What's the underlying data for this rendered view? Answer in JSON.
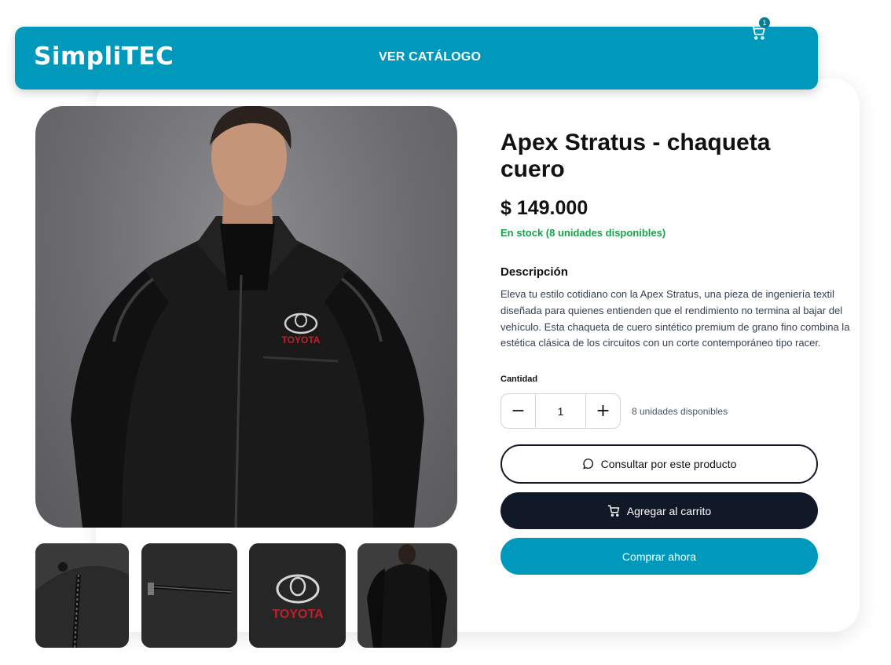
{
  "header": {
    "logo": "SimpliTEC",
    "nav_link": "VER CATÁLOGO",
    "cart_count": "1",
    "cart_icon": "cart-icon",
    "background": "#0099bb"
  },
  "gallery": {
    "main_image": "product-photo-man-in-leather-jacket",
    "main_logo_text": "TOYOTA",
    "thumbnails": [
      {
        "name": "thumb-zipper-collar"
      },
      {
        "name": "thumb-pocket-zipper"
      },
      {
        "name": "thumb-toyota-logo",
        "text": "TOYOTA"
      },
      {
        "name": "thumb-back-view"
      }
    ]
  },
  "product": {
    "title": "Apex Stratus - chaqueta cuero",
    "price": "$ 149.000",
    "stock": "En stock (8 unidades disponibles)",
    "stock_color": "#16a34a",
    "description_heading": "Descripción",
    "description": "Eleva tu estilo cotidiano con la Apex Stratus, una pieza de ingeniería textil diseñada para quienes entienden que el rendimiento no termina al bajar del vehículo. Esta chaqueta de cuero sintético premium de grano fino combina la estética clásica de los circuitos con un corte contemporáneo tipo racer.",
    "quantity_label": "Cantidad",
    "quantity_value": "1",
    "quantity_minus": "−",
    "quantity_plus": "+",
    "quantity_available": "8 unidades disponibles"
  },
  "actions": {
    "consult_label": "Consultar por este producto",
    "consult_icon": "chat-bubble-icon",
    "add_to_cart_label": "Agregar al carrito",
    "add_to_cart_icon": "cart-icon",
    "buy_now_label": "Comprar ahora",
    "dark_color": "#111827",
    "accent_color": "#0099bb"
  }
}
